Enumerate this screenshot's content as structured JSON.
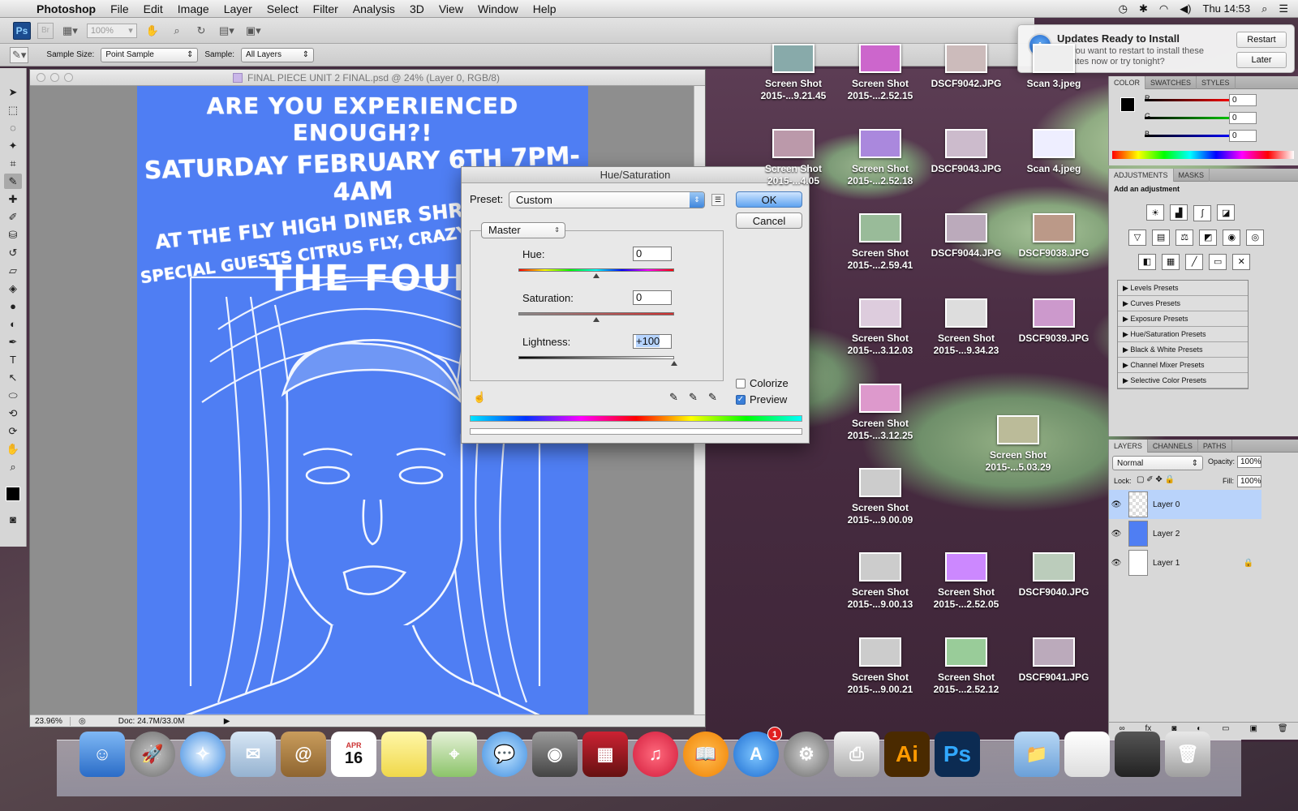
{
  "menubar": {
    "app": "Photoshop",
    "items": [
      "File",
      "Edit",
      "Image",
      "Layer",
      "Select",
      "Filter",
      "Analysis",
      "3D",
      "View",
      "Window",
      "Help"
    ],
    "clock": "Thu 14:53"
  },
  "appbar": {
    "ps": "Ps",
    "br": "Br",
    "zoom": "100%"
  },
  "options": {
    "sample_size_label": "Sample Size:",
    "sample_size_value": "Point Sample",
    "sample_label": "Sample:",
    "sample_value": "All Layers"
  },
  "document": {
    "title": "FINAL PIECE UNIT 2 FINAL.psd @ 24% (Layer 0, RGB/8)",
    "zoom": "23.96%",
    "doc_size": "Doc: 24.7M/33.0M"
  },
  "poster": {
    "line1": "ARE YOU EXPERIENCED ENOUGH?!",
    "line2": "SATURDAY FEBRUARY 6TH 7PM-4AM",
    "line3": "AT THE FLY HIGH DINER SHREWSBURY",
    "line4": "SPECIAL GUESTS CITRUS FLY, CRAZY TRIPS, MC G",
    "line5": "THE FOUR OW"
  },
  "dialog": {
    "title": "Hue/Saturation",
    "preset_label": "Preset:",
    "preset_value": "Custom",
    "ok": "OK",
    "cancel": "Cancel",
    "channel": "Master",
    "hue_label": "Hue:",
    "hue_value": "0",
    "sat_label": "Saturation:",
    "sat_value": "0",
    "light_label": "Lightness:",
    "light_value": "+100",
    "colorize": "Colorize",
    "preview": "Preview"
  },
  "notification": {
    "title": "Updates Ready to Install",
    "body": "Do you want to restart to install these updates now or try tonight?",
    "restart": "Restart",
    "later": "Later"
  },
  "desktop_icons": [
    {
      "l1": "Screen Shot",
      "l2": "2015-...9.21.45"
    },
    {
      "l1": "Screen Shot",
      "l2": "2015-...2.52.15"
    },
    {
      "l1": "DSCF9042.JPG",
      "l2": ""
    },
    {
      "l1": "Scan 3.jpeg",
      "l2": ""
    },
    {
      "l1": "Screen Shot",
      "l2": "2015-...4.05"
    },
    {
      "l1": "Screen Shot",
      "l2": "2015-...2.52.18"
    },
    {
      "l1": "DSCF9043.JPG",
      "l2": ""
    },
    {
      "l1": "Scan 4.jpeg",
      "l2": ""
    },
    {
      "l1": "Screen Shot",
      "l2": "2015-...2.59.41"
    },
    {
      "l1": "DSCF9044.JPG",
      "l2": ""
    },
    {
      "l1": "DSCF9038.JPG",
      "l2": ""
    },
    {
      "l1": "Screen Shot",
      "l2": "2015-...3.12.03"
    },
    {
      "l1": "Screen Shot",
      "l2": "2015-...9.34.23"
    },
    {
      "l1": "DSCF9039.JPG",
      "l2": ""
    },
    {
      "l1": "Screen Shot",
      "l2": "2015-...3.12.25"
    },
    {
      "l1": "Screen Shot",
      "l2": "2015-...9.00.09"
    },
    {
      "l1": "Screen Shot",
      "l2": "2015-...5.03.29"
    },
    {
      "l1": "Screen Shot",
      "l2": "2015-...9.00.13"
    },
    {
      "l1": "Screen Shot",
      "l2": "2015-...2.52.05"
    },
    {
      "l1": "DSCF9040.JPG",
      "l2": ""
    },
    {
      "l1": "Screen Shot",
      "l2": "2015-...9.00.21"
    },
    {
      "l1": "Screen Shot",
      "l2": "2015-...2.52.12"
    },
    {
      "l1": "DSCF9041.JPG",
      "l2": ""
    }
  ],
  "color_panel": {
    "tabs": [
      "COLOR",
      "SWATCHES",
      "STYLES"
    ],
    "r": "0",
    "g": "0",
    "b": "0",
    "r_label": "R",
    "g_label": "G",
    "b_label": "B"
  },
  "adjustments": {
    "tabs": [
      "ADJUSTMENTS",
      "MASKS"
    ],
    "heading": "Add an adjustment",
    "presets": [
      "Levels Presets",
      "Curves Presets",
      "Exposure Presets",
      "Hue/Saturation Presets",
      "Black & White Presets",
      "Channel Mixer Presets",
      "Selective Color Presets"
    ]
  },
  "layers": {
    "tabs": [
      "LAYERS",
      "CHANNELS",
      "PATHS"
    ],
    "blend": "Normal",
    "opacity_label": "Opacity:",
    "opacity": "100%",
    "lock_label": "Lock:",
    "fill_label": "Fill:",
    "fill": "100%",
    "items": [
      {
        "name": "Layer 0"
      },
      {
        "name": "Layer 2"
      },
      {
        "name": "Layer 1"
      }
    ]
  },
  "dock": {
    "calendar_month": "APR",
    "calendar_day": "16",
    "appstore_badge": "1",
    "ai": "Ai",
    "ps": "Ps"
  }
}
